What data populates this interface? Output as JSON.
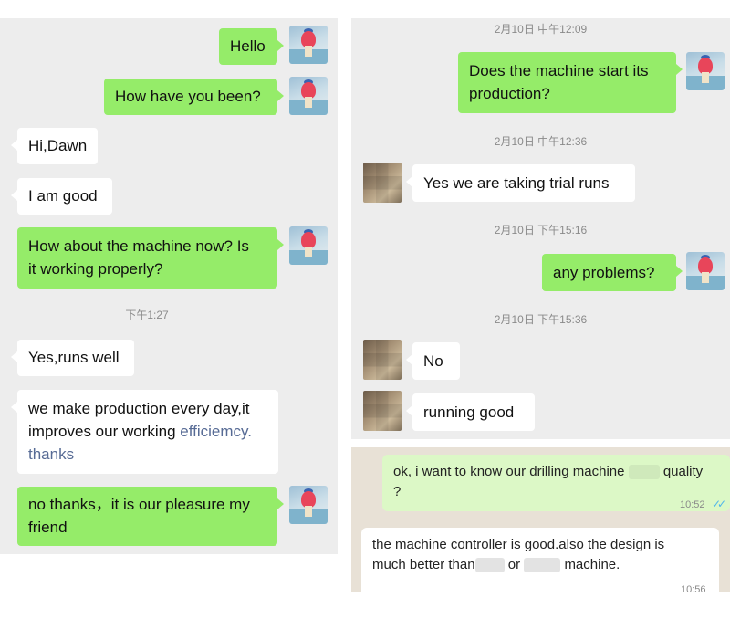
{
  "left_chat": {
    "messages": [
      {
        "side": "out",
        "text": "Hello"
      },
      {
        "side": "out",
        "text": "How have you been?"
      },
      {
        "side": "in",
        "text": "Hi,Dawn"
      },
      {
        "side": "in",
        "text": "I am good"
      },
      {
        "side": "out",
        "line1": "How about the machine now? Is",
        "line2": "it working properly?"
      },
      {
        "side": "in",
        "text": "Yes,runs well"
      },
      {
        "side": "in",
        "line1": "we make production every day,it",
        "line2a": "improves our working ",
        "line2b": "efficiemcy.",
        "line3": "thanks"
      },
      {
        "side": "out",
        "line1": "no thanks，it is our pleasure my",
        "line2": "friend"
      }
    ],
    "timestamp": "下午1:27"
  },
  "right_chat": {
    "timestamps": [
      "2月10日 中午12:09",
      "2月10日 中午12:36",
      "2月10日 下午15:16",
      "2月10日 下午15:36"
    ],
    "messages": [
      {
        "side": "out",
        "line1": "Does the machine start its",
        "line2": "production?"
      },
      {
        "side": "in",
        "text": "Yes we are taking trial runs"
      },
      {
        "side": "out",
        "text": "any problems?"
      },
      {
        "side": "in",
        "text": "No"
      },
      {
        "side": "in",
        "text": "running good"
      }
    ]
  },
  "whatsapp": {
    "out_line1a": "ok, i want to know our drilling machine",
    "out_line1b": "quality",
    "out_line2": "?",
    "out_time": "10:52",
    "ticks": "✓✓",
    "in_line1": "the machine controller is good.also the design is",
    "in_line2a": "much better than",
    "in_line2b": "or",
    "in_line2c": "machine.",
    "in_time": "10:56"
  },
  "colors": {
    "outgoing_bubble": "#95ec69",
    "incoming_bubble": "#ffffff",
    "chat_background": "#ededed",
    "whatsapp_outgoing": "#dcf8c6",
    "link_blue": "#576b95",
    "read_ticks": "#4fb6ec"
  }
}
